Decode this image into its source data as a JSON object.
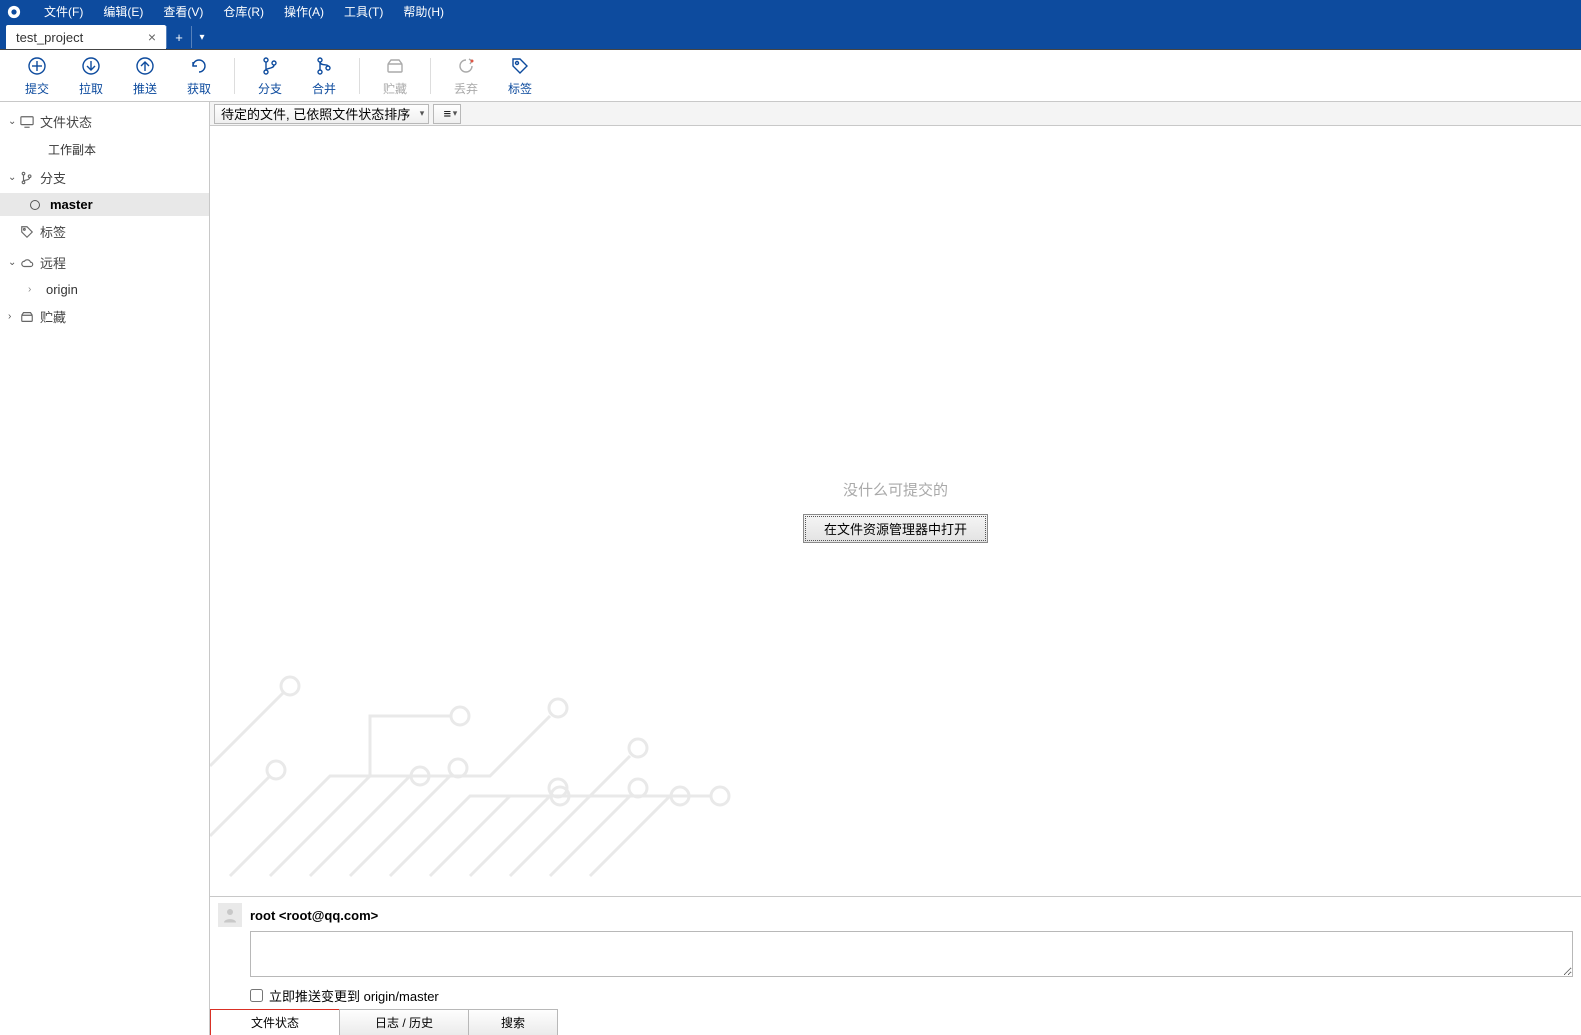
{
  "menubar": {
    "items": [
      {
        "label": "文件(F)"
      },
      {
        "label": "编辑(E)"
      },
      {
        "label": "查看(V)"
      },
      {
        "label": "仓库(R)"
      },
      {
        "label": "操作(A)"
      },
      {
        "label": "工具(T)"
      },
      {
        "label": "帮助(H)"
      }
    ]
  },
  "tabs": {
    "items": [
      {
        "label": "test_project"
      }
    ]
  },
  "toolbar": {
    "commit": "提交",
    "pull": "拉取",
    "push": "推送",
    "fetch": "获取",
    "branch": "分支",
    "merge": "合并",
    "stash": "贮藏",
    "discard": "丢弃",
    "tag": "标签"
  },
  "sidebar": {
    "sections": {
      "files": {
        "label": "文件状态",
        "sub": "工作副本"
      },
      "branches": {
        "label": "分支",
        "items": [
          "master"
        ]
      },
      "tags": {
        "label": "标签"
      },
      "remotes": {
        "label": "远程",
        "items": [
          "origin"
        ]
      },
      "stashes": {
        "label": "贮藏"
      }
    }
  },
  "filterbar": {
    "pending": "待定的文件, 已依照文件状态排序",
    "view_icon": "≡"
  },
  "empty": {
    "message": "没什么可提交的",
    "open_button": "在文件资源管理器中打开"
  },
  "commit": {
    "user_line": "root  <root@qq.com>",
    "push_checkbox": "立即推送变更到 origin/master"
  },
  "bottom_tabs": {
    "file_status": "文件状态",
    "log_history": "日志 / 历史",
    "search": "搜索"
  }
}
